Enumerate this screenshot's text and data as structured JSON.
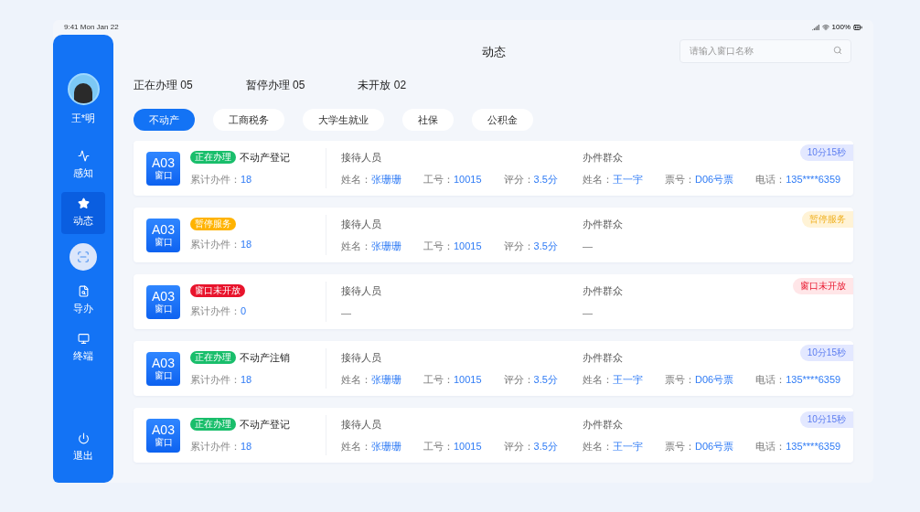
{
  "status_bar": {
    "time": "9:41",
    "date": "Mon Jan 22",
    "battery": "100%"
  },
  "sidebar": {
    "user": {
      "name": "王*明"
    },
    "items": [
      {
        "kind": "nav",
        "label": "感知",
        "selected": false
      },
      {
        "kind": "nav",
        "label": "动态",
        "selected": true
      },
      {
        "kind": "scan",
        "selected": false
      },
      {
        "kind": "nav",
        "label": "导办",
        "selected": false
      },
      {
        "kind": "nav",
        "label": "终端",
        "selected": false
      }
    ],
    "logout": {
      "label": "退出"
    }
  },
  "header": {
    "title": "动态",
    "search": {
      "placeholder": "请输入窗口名称"
    }
  },
  "stats": [
    {
      "label": "正在办理",
      "value": "05"
    },
    {
      "label": "暂停办理",
      "value": "05"
    },
    {
      "label": "未开放",
      "value": "02"
    }
  ],
  "tabs": [
    {
      "label": "不动产",
      "selected": true
    },
    {
      "label": "工商税务",
      "selected": false
    },
    {
      "label": "大学生就业",
      "selected": false
    },
    {
      "label": "社保",
      "selected": false
    },
    {
      "label": "公积金",
      "selected": false
    }
  ],
  "cards": [
    {
      "window": "A03",
      "window_label": "窗口",
      "kind": "active",
      "badge": "正在办理",
      "business": "不动产登记",
      "count_label": "累计办件：",
      "count": "18",
      "staff_title": "接待人员",
      "staff": [
        {
          "label": "姓名：",
          "value": "张珊珊"
        },
        {
          "label": "工号：",
          "value": "10015"
        },
        {
          "label": "评分：",
          "value": "3.5分"
        }
      ],
      "citizen_title": "办件群众",
      "citizen": [
        {
          "label": "姓名：",
          "value": "王一宇"
        },
        {
          "label": "票号：",
          "value": "D06号票"
        },
        {
          "label": "电话：",
          "value": "135****6359"
        }
      ],
      "tag": "10分15秒"
    },
    {
      "window": "A03",
      "window_label": "窗口",
      "kind": "paused",
      "badge": "暂停服务",
      "count_label": "累计办件：",
      "count": "18",
      "staff_title": "接待人员",
      "staff": [
        {
          "label": "姓名：",
          "value": "张珊珊"
        },
        {
          "label": "工号：",
          "value": "10015"
        },
        {
          "label": "评分：",
          "value": "3.5分"
        }
      ],
      "citizen_title": "办件群众",
      "citizen_empty": "—",
      "tag": "暂停服务"
    },
    {
      "window": "A03",
      "window_label": "窗口",
      "kind": "closed",
      "badge": "窗口未开放",
      "count_label": "累计办件：",
      "count": "0",
      "staff_title": "接待人员",
      "staff_empty": "—",
      "citizen_title": "办件群众",
      "citizen_empty": "—",
      "tag": "窗口未开放"
    },
    {
      "window": "A03",
      "window_label": "窗口",
      "kind": "active",
      "badge": "正在办理",
      "business": "不动产注销",
      "count_label": "累计办件：",
      "count": "18",
      "staff_title": "接待人员",
      "staff": [
        {
          "label": "姓名：",
          "value": "张珊珊"
        },
        {
          "label": "工号：",
          "value": "10015"
        },
        {
          "label": "评分：",
          "value": "3.5分"
        }
      ],
      "citizen_title": "办件群众",
      "citizen": [
        {
          "label": "姓名：",
          "value": "王一宇"
        },
        {
          "label": "票号：",
          "value": "D06号票"
        },
        {
          "label": "电话：",
          "value": "135****6359"
        }
      ],
      "tag": "10分15秒"
    },
    {
      "window": "A03",
      "window_label": "窗口",
      "kind": "active",
      "badge": "正在办理",
      "business": "不动产登记",
      "count_label": "累计办件：",
      "count": "18",
      "staff_title": "接待人员",
      "staff": [
        {
          "label": "姓名：",
          "value": "张珊珊"
        },
        {
          "label": "工号：",
          "value": "10015"
        },
        {
          "label": "评分：",
          "value": "3.5分"
        }
      ],
      "citizen_title": "办件群众",
      "citizen": [
        {
          "label": "姓名：",
          "value": "王一宇"
        },
        {
          "label": "票号：",
          "value": "D06号票"
        },
        {
          "label": "电话：",
          "value": "135****6359"
        }
      ],
      "tag": "10分15秒"
    }
  ]
}
